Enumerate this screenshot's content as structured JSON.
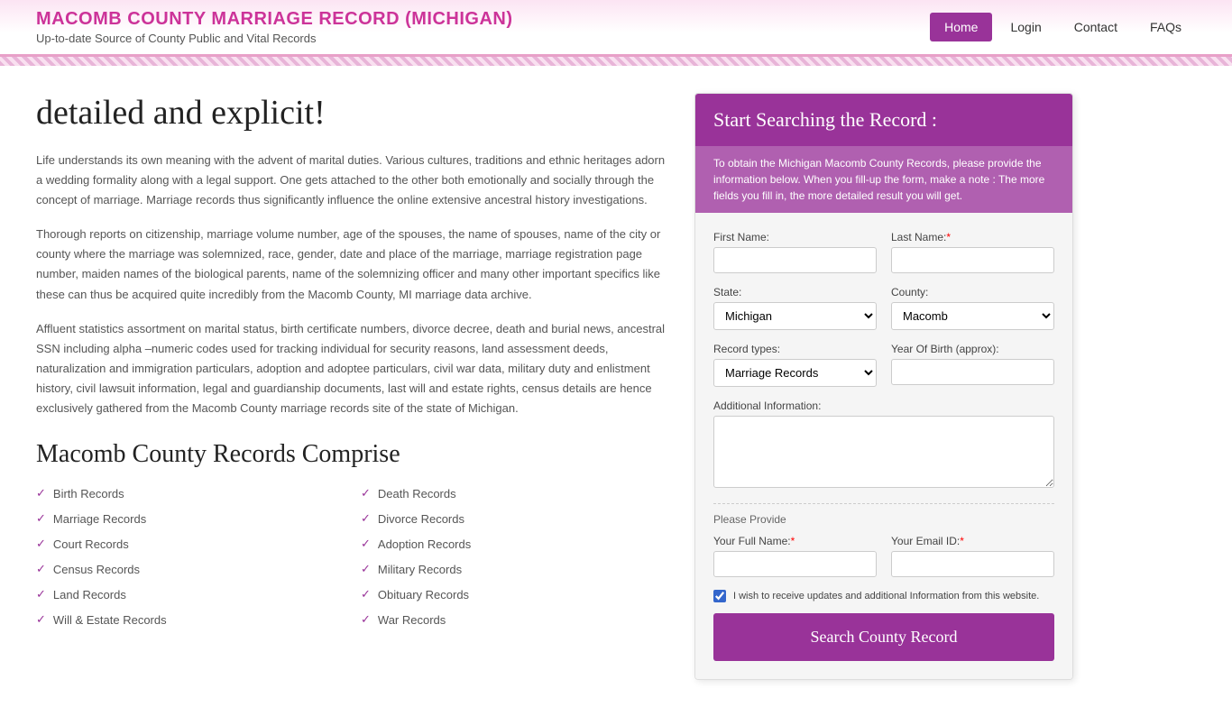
{
  "header": {
    "title": "MACOMB COUNTY MARRIAGE RECORD (MICHIGAN)",
    "subtitle": "Up-to-date Source of  County Public and Vital Records",
    "nav": [
      {
        "label": "Home",
        "active": true
      },
      {
        "label": "Login",
        "active": false
      },
      {
        "label": "Contact",
        "active": false
      },
      {
        "label": "FAQs",
        "active": false
      }
    ]
  },
  "content": {
    "heading": "detailed and explicit!",
    "paragraph1": "Life understands its own meaning with the advent of marital duties. Various cultures, traditions and ethnic heritages adorn a wedding formality along with a legal support. One gets attached to the other both emotionally and socially through the concept of marriage. Marriage records thus significantly influence the online extensive ancestral history investigations.",
    "paragraph2": "Thorough reports on citizenship, marriage volume number, age of the spouses, the name of spouses, name of the city or county where the marriage was solemnized, race, gender, date and place of the marriage, marriage registration page number, maiden names of the biological parents, name of the solemnizing officer and many other important specifics like these can thus be acquired quite incredibly from the Macomb County, MI marriage data archive.",
    "paragraph3": "Affluent statistics assortment on marital status, birth certificate numbers, divorce decree, death and burial news, ancestral SSN including alpha –numeric codes used for tracking individual for security reasons, land assessment deeds, naturalization and immigration particulars, adoption and adoptee particulars, civil war data, military duty and enlistment history, civil lawsuit information, legal and guardianship documents, last will and estate rights, census details are hence exclusively gathered from the Macomb County marriage records site of the state of Michigan.",
    "records_heading": "Macomb County Records Comprise",
    "records": [
      {
        "label": "Birth Records",
        "col": 1
      },
      {
        "label": "Marriage Records",
        "col": 1
      },
      {
        "label": "Court Records",
        "col": 1
      },
      {
        "label": "Census Records",
        "col": 1
      },
      {
        "label": "Land Records",
        "col": 1
      },
      {
        "label": "Will & Estate Records",
        "col": 1
      },
      {
        "label": "Death Records",
        "col": 2
      },
      {
        "label": "Divorce Records",
        "col": 2
      },
      {
        "label": "Adoption Records",
        "col": 2
      },
      {
        "label": "Military Records",
        "col": 2
      },
      {
        "label": "Obituary Records",
        "col": 2
      },
      {
        "label": "War Records",
        "col": 2
      }
    ]
  },
  "form": {
    "header": "Start Searching the Record :",
    "description": "To obtain the Michigan Macomb County Records, please provide the information below. When you fill-up the form, make a note : The more fields you fill in, the more detailed result you will get.",
    "first_name_label": "First Name:",
    "last_name_label": "Last Name:",
    "last_name_required": "*",
    "state_label": "State:",
    "county_label": "County:",
    "record_types_label": "Record types:",
    "year_birth_label": "Year Of Birth (approx):",
    "additional_label": "Additional Information:",
    "please_provide": "Please Provide",
    "full_name_label": "Your Full Name:",
    "full_name_required": "*",
    "email_label": "Your Email ID:",
    "email_required": "*",
    "checkbox_label": "I wish to receive updates and additional Information from this website.",
    "search_btn_label": "Search County Record",
    "state_options": [
      "Michigan"
    ],
    "county_options": [
      "Macomb"
    ],
    "record_type_options": [
      "Marriage Records",
      "Birth Records",
      "Death Records",
      "Divorce Records"
    ]
  }
}
